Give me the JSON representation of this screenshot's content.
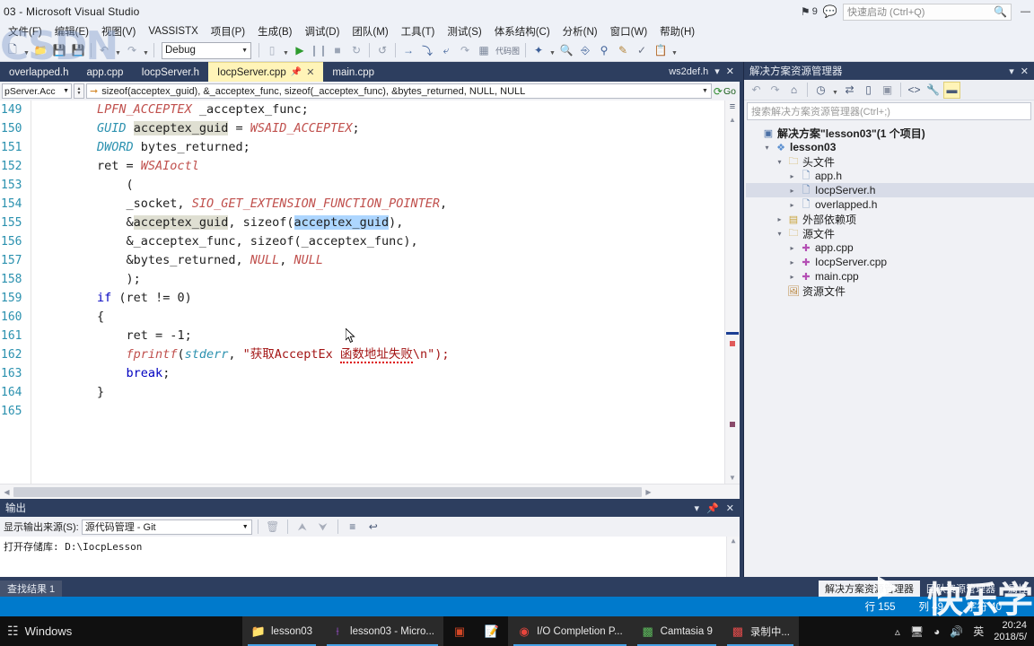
{
  "titlebar": {
    "title": "03 - Microsoft Visual Studio",
    "notification_count": "9",
    "flag_icon": "flag-icon",
    "feedback_icon": "feedback-icon",
    "quick_launch_placeholder": "快速启动 (Ctrl+Q)",
    "search_icon": "search-icon",
    "minimize": "—",
    "maximize": "▢",
    "close": "✕"
  },
  "menubar": {
    "items": [
      {
        "label": "文件(F)"
      },
      {
        "label": "编辑(E)"
      },
      {
        "label": "视图(V)"
      },
      {
        "label": "VASSISTX"
      },
      {
        "label": "项目(P)"
      },
      {
        "label": "生成(B)"
      },
      {
        "label": "调试(D)"
      },
      {
        "label": "团队(M)"
      },
      {
        "label": "工具(T)"
      },
      {
        "label": "测试(S)"
      },
      {
        "label": "体系结构(C)"
      },
      {
        "label": "分析(N)"
      },
      {
        "label": "窗口(W)"
      },
      {
        "label": "帮助(H)"
      }
    ]
  },
  "toolbar": {
    "new_project_icon": "new-project-icon",
    "open_file_icon": "open-file-icon",
    "save_icon": "save-icon",
    "save_all_icon": "save-all-icon",
    "undo_icon": "undo-icon",
    "redo_icon": "redo-icon",
    "configuration": "Debug",
    "attach_icon": "attach-icon",
    "start_icon": "start-debug-icon",
    "pause_icon": "pause-icon",
    "stop_icon": "stop-icon",
    "restart_icon": "restart-icon",
    "refresh_icon": "refresh-icon",
    "step_icon": "step-over-icon",
    "step_into_icon": "step-into-icon",
    "step_out_icon": "step-out-icon",
    "next_icon": "next-statement-icon",
    "code_map_label": "代码图",
    "vassist_icon": "vassist-icon",
    "find_ref_icon": "find-reference-icon",
    "find_symbol_icon": "find-symbol-icon",
    "rename_icon": "rename-icon",
    "spell_icon": "spell-check-icon",
    "paste_icon": "paste-special-icon"
  },
  "tabs": {
    "items": [
      {
        "label": "overlapped.h",
        "active": false
      },
      {
        "label": "app.cpp",
        "active": false
      },
      {
        "label": "IocpServer.h",
        "active": false
      },
      {
        "label": "IocpServer.cpp",
        "active": true
      },
      {
        "label": "main.cpp",
        "active": false
      }
    ],
    "right_label": "ws2def.h",
    "pin_icon": "pin-icon",
    "close_icon": "close-icon",
    "dropdown_icon": "tab-dropdown-icon"
  },
  "navbar": {
    "scope": "pServer.Acc",
    "find_text": "sizeof(acceptex_guid), &_acceptex_func, sizeof(_acceptex_func), &bytes_returned, NULL, NULL",
    "go_label": "Go",
    "arrow_icon": "find-arrow-icon",
    "go_icon": "go-icon"
  },
  "editor": {
    "lines": [
      {
        "num": "149",
        "indent": 8,
        "tokens": [
          {
            "t": "LPFN_ACCEPTEX",
            "c": "macro"
          },
          {
            "t": " _acceptex_func;",
            "c": ""
          }
        ]
      },
      {
        "num": "150",
        "indent": 8,
        "tokens": [
          {
            "t": "GUID",
            "c": "type"
          },
          {
            "t": " ",
            "c": ""
          },
          {
            "t": "acceptex_guid",
            "c": "hl"
          },
          {
            "t": " = ",
            "c": ""
          },
          {
            "t": "WSAID_ACCEPTEX",
            "c": "macro"
          },
          {
            "t": ";",
            "c": ""
          }
        ]
      },
      {
        "num": "151",
        "indent": 8,
        "tokens": [
          {
            "t": "DWORD",
            "c": "type"
          },
          {
            "t": " bytes_returned;",
            "c": ""
          }
        ]
      },
      {
        "num": "152",
        "indent": 8,
        "tokens": [
          {
            "t": "ret = ",
            "c": ""
          },
          {
            "t": "WSAIoctl",
            "c": "fn"
          }
        ]
      },
      {
        "num": "153",
        "indent": 12,
        "tokens": [
          {
            "t": "(",
            "c": ""
          }
        ]
      },
      {
        "num": "154",
        "indent": 12,
        "tokens": [
          {
            "t": "_socket, ",
            "c": ""
          },
          {
            "t": "SIO_GET_EXTENSION_FUNCTION_POINTER",
            "c": "macro"
          },
          {
            "t": ",",
            "c": ""
          }
        ]
      },
      {
        "num": "155",
        "indent": 12,
        "tokens": [
          {
            "t": "&",
            "c": ""
          },
          {
            "t": "acceptex_guid",
            "c": "hl"
          },
          {
            "t": ", sizeof(",
            "c": ""
          },
          {
            "t": "acceptex_guid",
            "c": "sel"
          },
          {
            "t": "),",
            "c": ""
          }
        ]
      },
      {
        "num": "156",
        "indent": 12,
        "tokens": [
          {
            "t": "&_acceptex_func, sizeof(_acceptex_func),",
            "c": ""
          }
        ]
      },
      {
        "num": "157",
        "indent": 12,
        "tokens": [
          {
            "t": "&bytes_returned, ",
            "c": ""
          },
          {
            "t": "NULL",
            "c": "macro"
          },
          {
            "t": ", ",
            "c": ""
          },
          {
            "t": "NULL",
            "c": "macro"
          }
        ]
      },
      {
        "num": "158",
        "indent": 12,
        "tokens": [
          {
            "t": ");",
            "c": ""
          }
        ]
      },
      {
        "num": "159",
        "indent": 8,
        "tokens": [
          {
            "t": "if",
            "c": "kw"
          },
          {
            "t": " (ret != ",
            "c": ""
          },
          {
            "t": "0",
            "c": "num"
          },
          {
            "t": ")",
            "c": ""
          }
        ]
      },
      {
        "num": "160",
        "indent": 8,
        "tokens": [
          {
            "t": "{",
            "c": ""
          }
        ]
      },
      {
        "num": "161",
        "indent": 12,
        "tokens": [
          {
            "t": "ret = -",
            "c": ""
          },
          {
            "t": "1",
            "c": "num"
          },
          {
            "t": ";",
            "c": ""
          }
        ]
      },
      {
        "num": "162",
        "indent": 12,
        "tokens": [
          {
            "t": "fprintf",
            "c": "fn"
          },
          {
            "t": "(",
            "c": ""
          },
          {
            "t": "stderr",
            "c": "type"
          },
          {
            "t": ", ",
            "c": ""
          },
          {
            "t": "\"获取AcceptEx ",
            "c": "str"
          },
          {
            "t": "函数地址失败",
            "c": "str sq"
          },
          {
            "t": "\\n\");",
            "c": "str"
          }
        ]
      },
      {
        "num": "163",
        "indent": 12,
        "tokens": [
          {
            "t": "break",
            "c": "kw"
          },
          {
            "t": ";",
            "c": ""
          }
        ]
      },
      {
        "num": "164",
        "indent": 8,
        "tokens": [
          {
            "t": "}",
            "c": ""
          }
        ]
      },
      {
        "num": "165",
        "indent": 0,
        "tokens": [
          {
            "t": "",
            "c": ""
          }
        ]
      }
    ]
  },
  "output": {
    "title": "输出",
    "dropdown_icon": "panel-dropdown-icon",
    "pin_icon": "panel-pin-icon",
    "close_icon": "panel-close-icon",
    "source_label": "显示输出来源(S):",
    "source_value": "源代码管理 - Git",
    "clear_icon": "clear-output-icon",
    "nav_up_icon": "go-up-icon",
    "nav_down_icon": "go-down-icon",
    "clear_all_icon": "clear-all-icon",
    "wrap_icon": "word-wrap-icon",
    "body_text": "打开存储库:  D:\\IocpLesson"
  },
  "solution_explorer": {
    "title": "解决方案资源管理器",
    "dropdown_icon": "panel-dropdown-icon",
    "close_icon": "panel-close-icon",
    "toolbar": [
      {
        "icon": "back-icon"
      },
      {
        "icon": "forward-icon"
      },
      {
        "icon": "home-icon"
      },
      {
        "icon": "pending-changes-icon"
      },
      {
        "icon": "sync-icon"
      },
      {
        "icon": "show-all-files-icon"
      },
      {
        "icon": "refresh-icon"
      },
      {
        "icon": "collapse-all-icon"
      },
      {
        "icon": "code-view-icon"
      },
      {
        "icon": "properties-icon"
      },
      {
        "icon": "preview-selected-icon"
      }
    ],
    "search_placeholder": "搜索解决方案资源管理器(Ctrl+;)",
    "tree": [
      {
        "depth": 0,
        "expander": "",
        "icon": "solution-icon",
        "label": "解决方案\"lesson03\"(1 个项目)",
        "bold": true,
        "selected": false
      },
      {
        "depth": 1,
        "expander": "▲",
        "icon": "project-icon",
        "label": "lesson03",
        "bold": true,
        "selected": false
      },
      {
        "depth": 2,
        "expander": "▲",
        "icon": "folder-icon",
        "label": "头文件",
        "bold": false,
        "selected": false
      },
      {
        "depth": 3,
        "expander": "▶",
        "icon": "header-icon",
        "label": "app.h",
        "bold": false,
        "selected": false
      },
      {
        "depth": 3,
        "expander": "▶",
        "icon": "header-icon",
        "label": "IocpServer.h",
        "bold": false,
        "selected": true
      },
      {
        "depth": 3,
        "expander": "▶",
        "icon": "header-icon",
        "label": "overlapped.h",
        "bold": false,
        "selected": false
      },
      {
        "depth": 2,
        "expander": "▶",
        "icon": "refs-icon",
        "label": "外部依赖项",
        "bold": false,
        "selected": false
      },
      {
        "depth": 2,
        "expander": "▲",
        "icon": "folder-icon",
        "label": "源文件",
        "bold": false,
        "selected": false
      },
      {
        "depth": 3,
        "expander": "▶",
        "icon": "cpp-icon",
        "label": "app.cpp",
        "bold": false,
        "selected": false
      },
      {
        "depth": 3,
        "expander": "▶",
        "icon": "cpp-icon",
        "label": "IocpServer.cpp",
        "bold": false,
        "selected": false
      },
      {
        "depth": 3,
        "expander": "▶",
        "icon": "cpp-icon",
        "label": "main.cpp",
        "bold": false,
        "selected": false
      },
      {
        "depth": 2,
        "expander": "",
        "icon": "resource-icon",
        "label": "资源文件",
        "bold": false,
        "selected": false
      }
    ]
  },
  "bottom_tabs": {
    "left": [
      {
        "label": "查找结果 1",
        "active": true
      }
    ],
    "right": [
      {
        "label": "解决方案资源管理器",
        "active": true
      },
      {
        "label": "团队资源管理器",
        "active": false
      },
      {
        "label": "属性",
        "active": false
      }
    ]
  },
  "statusbar": {
    "ready": "",
    "line_label": "行 155",
    "col_label": "列 49",
    "char_label": "字符 40"
  },
  "taskbar": {
    "start_label": "Windows",
    "start_icon": "windows-start-icon",
    "apps": [
      {
        "label": "lesson03",
        "icon": "folder-icon",
        "running": true
      },
      {
        "label": "lesson03 - Micro...",
        "icon": "visual-studio-icon",
        "running": true
      },
      {
        "label": "",
        "icon": "powerpoint-icon",
        "running": false
      },
      {
        "label": "",
        "icon": "notepad-icon",
        "running": false
      },
      {
        "label": "I/O Completion P...",
        "icon": "chrome-icon",
        "running": true
      },
      {
        "label": "Camtasia 9",
        "icon": "camtasia-icon",
        "running": true
      },
      {
        "label": "录制中...",
        "icon": "camtasia-recorder-icon",
        "running": true
      }
    ],
    "tray": [
      {
        "icon": "chevron-up-icon"
      },
      {
        "icon": "monitor-icon"
      },
      {
        "icon": "wifi-icon"
      },
      {
        "icon": "volume-icon"
      },
      {
        "icon": "ime-icon",
        "label": "英"
      }
    ],
    "clock_time": "20:24",
    "clock_date": "2018/5/"
  },
  "watermarks": {
    "csdn": "CSDN",
    "kuai": "快乐学"
  }
}
